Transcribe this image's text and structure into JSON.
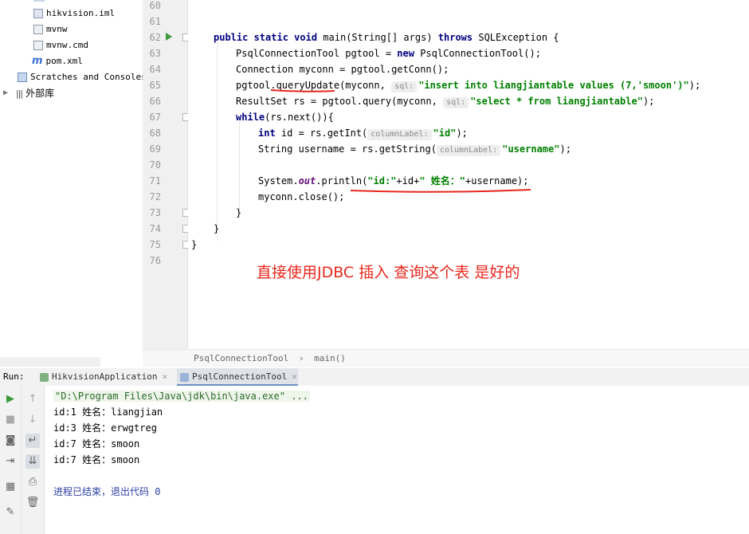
{
  "project_tree": {
    "items": [
      {
        "icon": "module-file-icon",
        "label": "hikvision.iml"
      },
      {
        "icon": "script-file-icon",
        "label": "mvnw"
      },
      {
        "icon": "script-file-icon",
        "label": "mvnw.cmd"
      },
      {
        "icon": "maven-icon",
        "label": "pom.xml"
      },
      {
        "icon": "scratches-icon",
        "label": "Scratches and Consoles"
      },
      {
        "icon": "libraries-icon",
        "label": "外部库"
      }
    ]
  },
  "editor": {
    "line_numbers": [
      "60",
      "61",
      "62",
      "63",
      "64",
      "65",
      "66",
      "67",
      "68",
      "69",
      "70",
      "71",
      "72",
      "73",
      "74",
      "75",
      "76"
    ],
    "code": {
      "l62": {
        "kw1": "public static void ",
        "name": "main",
        "params": "(String[] args) ",
        "kw2": "throws ",
        "rest": "SQLException {"
      },
      "l63": {
        "a": "PsqlConnectionTool pgtool = ",
        "kw": "new ",
        "b": "PsqlConnectionTool();"
      },
      "l64": {
        "a": "Connection myconn = pgtool.getConn();"
      },
      "l65": {
        "a": "pgtool.",
        "method": "queryUpdate",
        "b": "(myconn, ",
        "hint": "sql:",
        "str": "\"insert into liangjiantable values (7,'smoon')\"",
        "c": ");"
      },
      "l66": {
        "a": "ResultSet rs = pgtool.query(myconn, ",
        "hint": "sql:",
        "str": "\"select * from liangjiantable\"",
        "c": ");"
      },
      "l67": {
        "kw": "while",
        "a": "(rs.next()){"
      },
      "l68": {
        "kw": "int ",
        "a": "id = rs.getInt(",
        "hint": "columnLabel:",
        "str": "\"id\"",
        "c": ");"
      },
      "l69": {
        "a": "String username = rs.getString(",
        "hint": "columnLabel:",
        "str": "\"username\"",
        "c": ");"
      },
      "l71": {
        "a": "System.",
        "field": "out",
        "b": ".println(",
        "str1": "\"id:\"",
        "c": "+id+",
        "str2": "\" 姓名：\"",
        "d": "+username);"
      },
      "l72": {
        "a": "myconn.close();"
      },
      "l73": {
        "a": "}"
      },
      "l74": {
        "a": "}"
      },
      "l75": {
        "a": "}"
      }
    },
    "annotation": "直接使用JDBC 插入 查询这个表 是好的"
  },
  "breadcrumb": {
    "class_name": "PsqlConnectionTool",
    "separator": "›",
    "method": "main()"
  },
  "run_panel": {
    "label": "Run:",
    "tabs": [
      {
        "label": "HikvisionApplication",
        "close": "×",
        "active": false
      },
      {
        "label": "PsqlConnectionTool",
        "close": "×",
        "active": true
      }
    ],
    "console": {
      "command": "\"D:\\Program Files\\Java\\jdk\\bin\\java.exe\" ...",
      "output": [
        "id:1 姓名：liangjian",
        "id:3 姓名：erwgtreg",
        "id:7 姓名：smoon",
        "id:7 姓名：smoon"
      ],
      "exit_message": "进程已结束，退出代码 0"
    }
  },
  "colors": {
    "keyword": "#000080",
    "string": "#008000",
    "annotation": "#e8271e",
    "run_green": "#3c9a3c"
  }
}
